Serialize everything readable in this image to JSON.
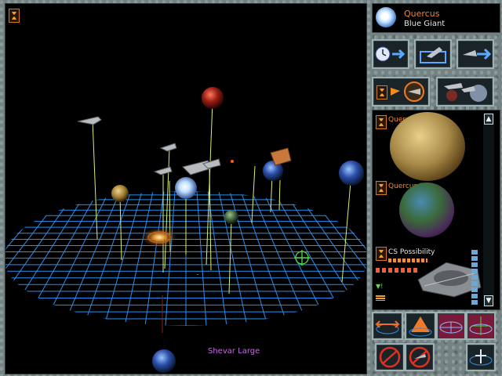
{
  "selected_star": {
    "name": "Quercus",
    "type": "Blue Giant",
    "icon": "blue-giant-star-icon"
  },
  "planets": [
    {
      "name": "Quercus I",
      "icon": "desert-planet-icon"
    },
    {
      "name": "Quercus II",
      "icon": "ocean-planet-icon"
    }
  ],
  "ship_entry": {
    "label": "CS Possibility",
    "icon": "colony-ship-icon"
  },
  "grid_label": "Shevar Large",
  "scroll": {
    "up": "▲",
    "down": "▼"
  },
  "colors": {
    "grid": "#2a8ff0",
    "stalk": "#d8f070",
    "accent": "#e9863a"
  }
}
